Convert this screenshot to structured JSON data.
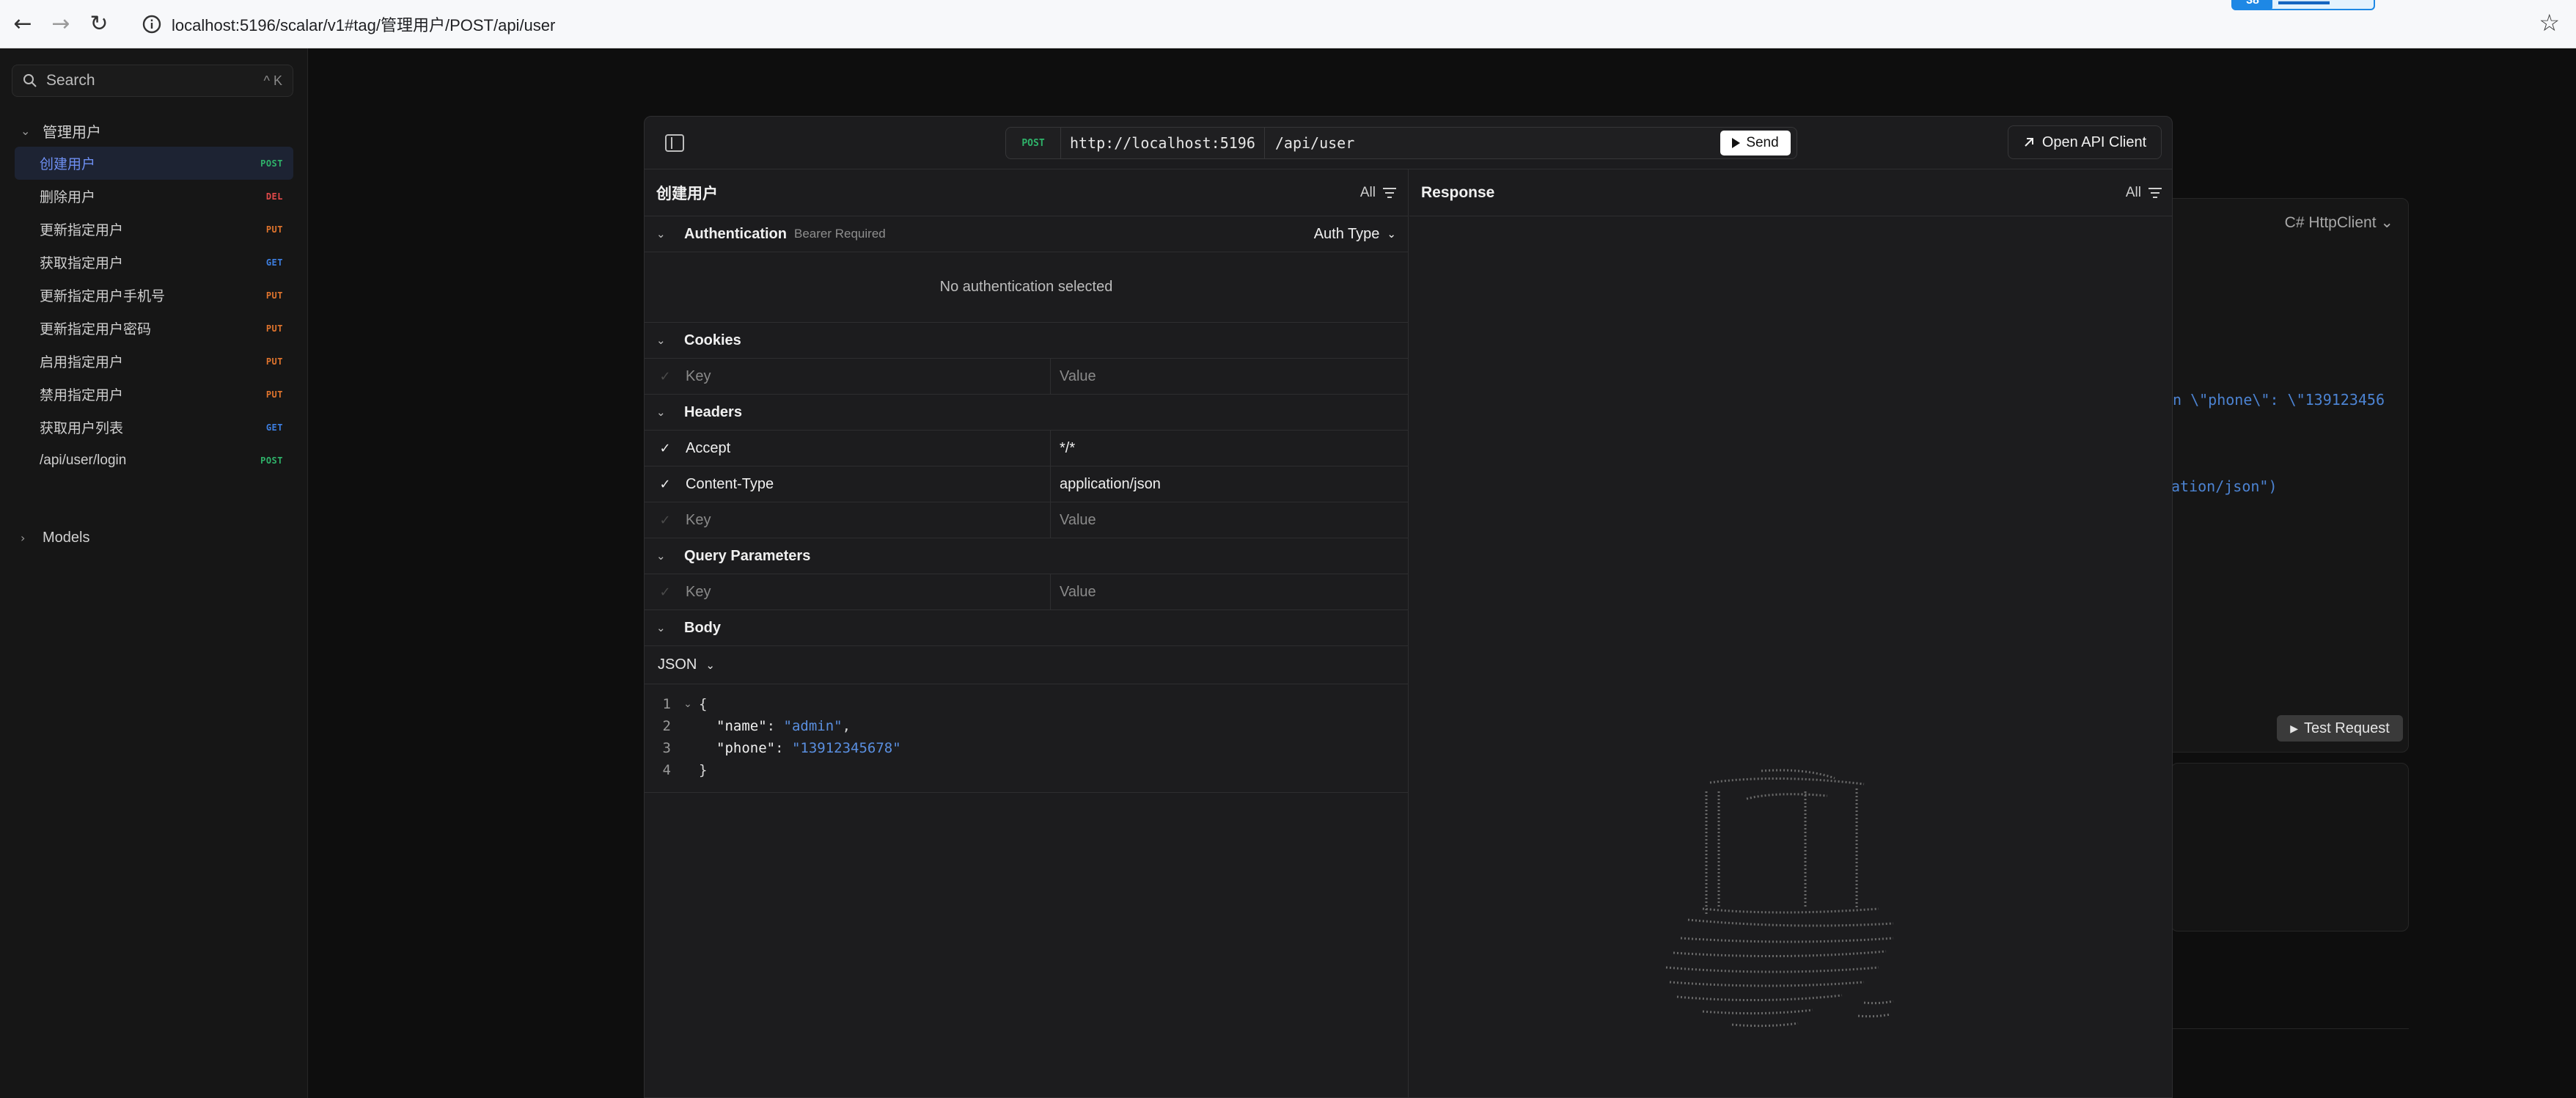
{
  "browser": {
    "url": "localhost:5196/scalar/v1#tag/管理用户/POST/api/user",
    "ext_badge": "38"
  },
  "sidebar": {
    "search_placeholder": "Search",
    "search_shortcut": "^ K",
    "group_label": "管理用户",
    "items": [
      {
        "label": "创建用户",
        "method": "POST"
      },
      {
        "label": "删除用户",
        "method": "DEL"
      },
      {
        "label": "更新指定用户",
        "method": "PUT"
      },
      {
        "label": "获取指定用户",
        "method": "GET"
      },
      {
        "label": "更新指定用户手机号",
        "method": "PUT"
      },
      {
        "label": "更新指定用户密码",
        "method": "PUT"
      },
      {
        "label": "启用指定用户",
        "method": "PUT"
      },
      {
        "label": "禁用指定用户",
        "method": "PUT"
      },
      {
        "label": "获取用户列表",
        "method": "GET"
      },
      {
        "label": "/api/user/login",
        "method": "POST"
      }
    ],
    "models_label": "Models"
  },
  "background": {
    "language": "C# HttpClient",
    "snippet_1": "n  \\\"phone\\\": \\\"139123456",
    "snippet_2": "ation/json\")",
    "test_request": "Test Request"
  },
  "modal": {
    "method": "POST",
    "host": "http://localhost:5196",
    "path": "/api/user",
    "send_label": "Send",
    "open_client_label": "Open API Client",
    "request_title": "创建用户",
    "response_title": "Response",
    "filter_label": "All",
    "auth": {
      "label": "Authentication",
      "requirement": "Bearer Required",
      "type_label": "Auth Type",
      "empty": "No authentication selected"
    },
    "cookies_label": "Cookies",
    "headers_label": "Headers",
    "query_label": "Query Parameters",
    "body_label": "Body",
    "key_placeholder": "Key",
    "value_placeholder": "Value",
    "headers": [
      {
        "key": "Accept",
        "value": "*/*"
      },
      {
        "key": "Content-Type",
        "value": "application/json"
      }
    ],
    "body_format": "JSON",
    "body_lines": {
      "l1": "{",
      "l2_key": "\"name\"",
      "l2_val": "\"admin\"",
      "l3_key": "\"phone\"",
      "l3_val": "\"13912345678\"",
      "l4": "}"
    }
  }
}
